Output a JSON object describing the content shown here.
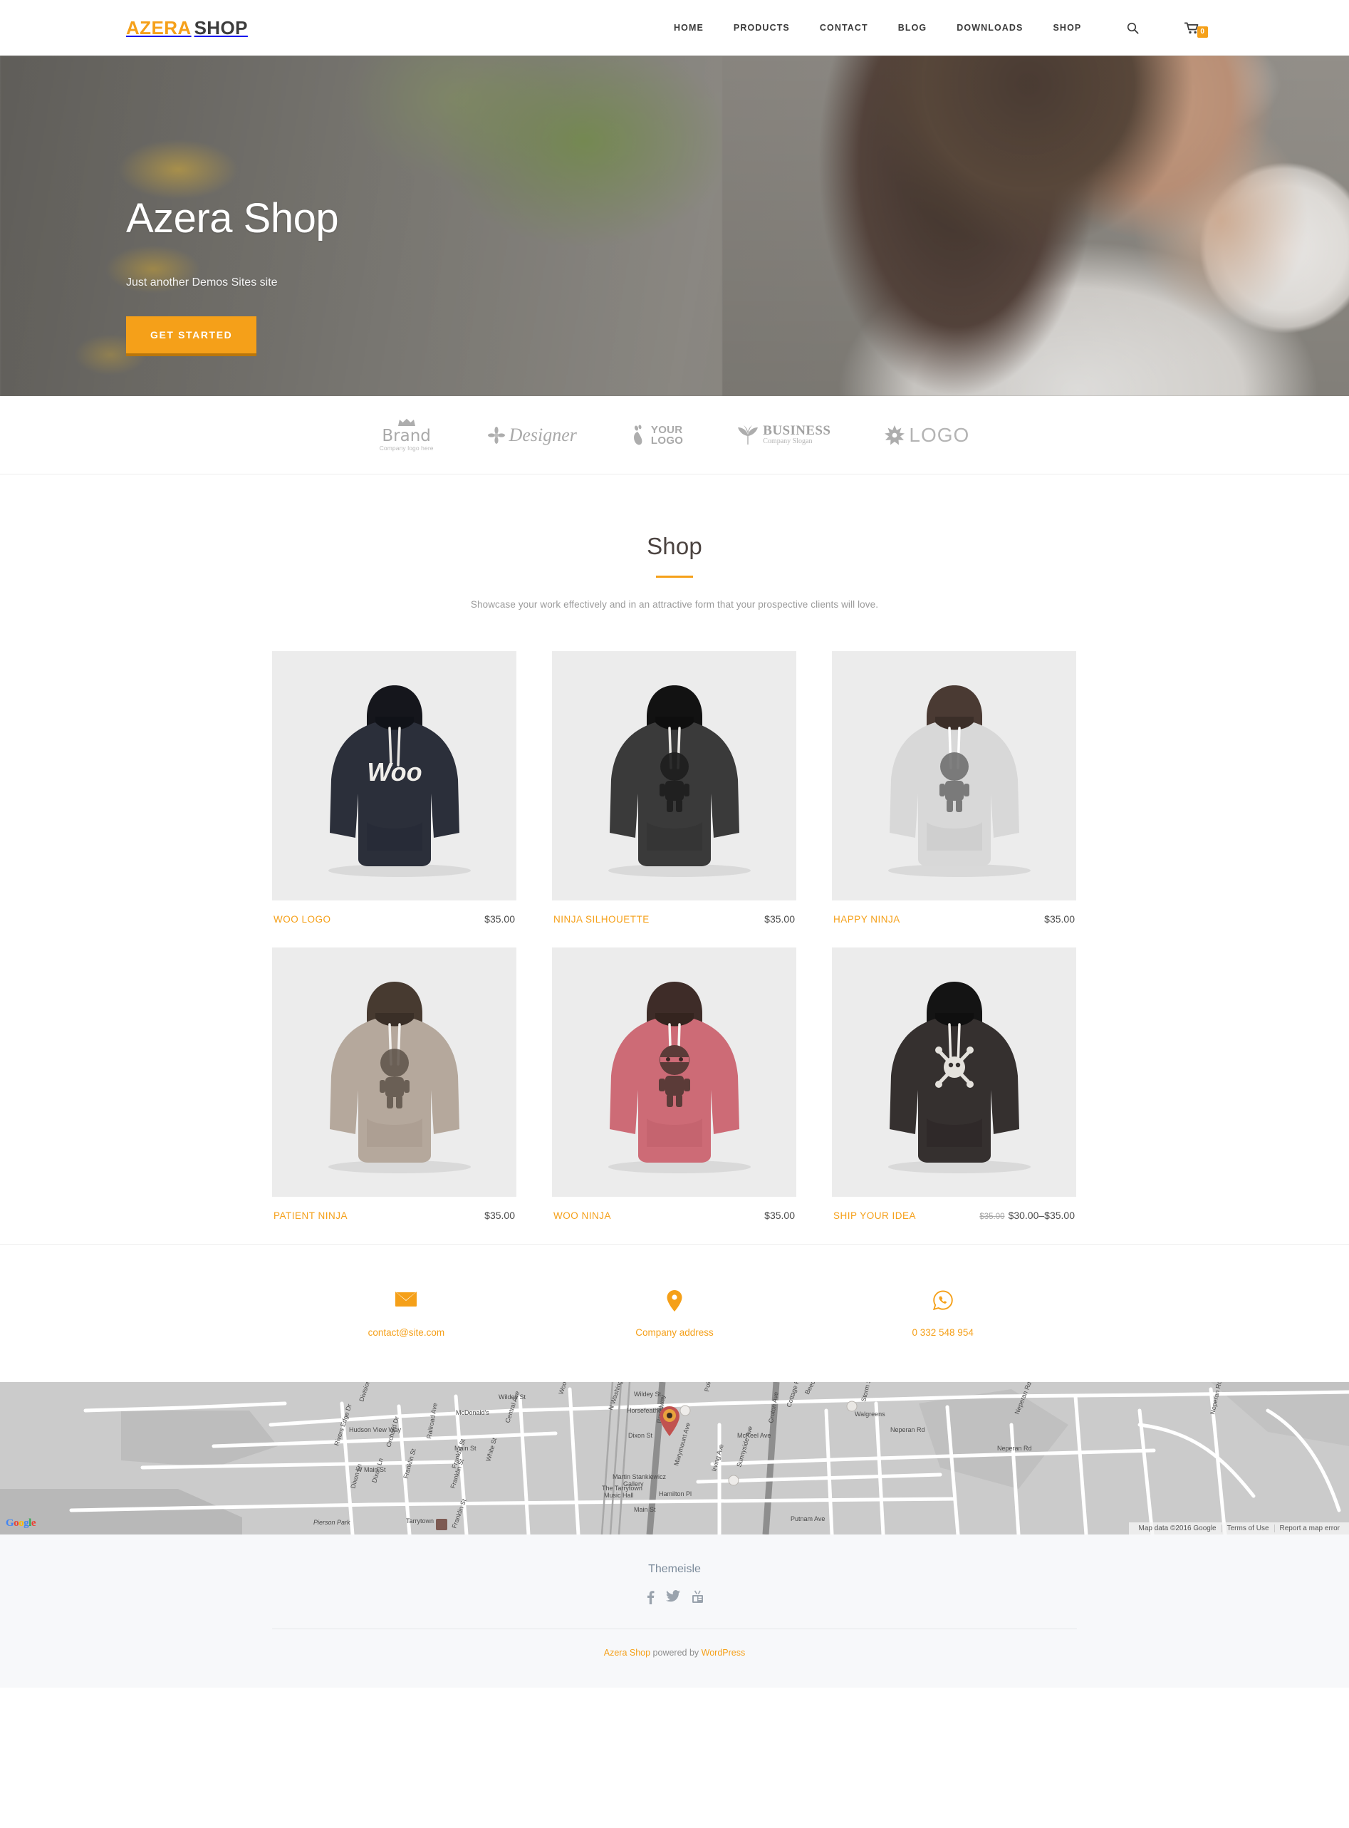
{
  "header": {
    "logo": {
      "part1": "AZERA",
      "part2": "SHOP"
    },
    "nav": [
      {
        "label": "HOME"
      },
      {
        "label": "PRODUCTS"
      },
      {
        "label": "CONTACT"
      },
      {
        "label": "BLOG"
      },
      {
        "label": "DOWNLOADS"
      },
      {
        "label": "SHOP"
      }
    ],
    "search_icon": "search-icon",
    "cart_icon": "shopping-cart-icon",
    "cart_count": "0"
  },
  "hero": {
    "title": "Azera Shop",
    "subtitle": "Just another Demos Sites site",
    "cta": "GET STARTED"
  },
  "clients": [
    {
      "name": "Brand",
      "sub": "Company logo here",
      "icon": "crown-icon"
    },
    {
      "name": "Designer",
      "sub": "",
      "icon": "flower-icon"
    },
    {
      "name": "YOUR",
      "name2": "LOGO",
      "sub": "",
      "icon": "footprint-icon"
    },
    {
      "name": "BUSINESS",
      "sub": "Company Slogan",
      "icon": "leaf-icon"
    },
    {
      "name": "LOGO",
      "sub": "",
      "icon": "starburst-icon"
    }
  ],
  "shop": {
    "title": "Shop",
    "subtitle": "Showcase your work effectively and in an attractive form that your prospective clients will love.",
    "products": [
      {
        "name": "WOO LOGO",
        "price": "$35.00",
        "old_price": "",
        "color": "#2b2f3a",
        "graphic": "woo"
      },
      {
        "name": "NINJA SILHOUETTE",
        "price": "$35.00",
        "old_price": "",
        "color": "#3a3a3a",
        "graphic": "ninja"
      },
      {
        "name": "HAPPY NINJA",
        "price": "$35.00",
        "old_price": "",
        "color": "#d8d8d8",
        "graphic": "ninja"
      },
      {
        "name": "PATIENT NINJA",
        "price": "$35.00",
        "old_price": "",
        "color": "#b5a89c",
        "graphic": "ninja"
      },
      {
        "name": "WOO NINJA",
        "price": "$35.00",
        "old_price": "",
        "color": "#cd6b76",
        "graphic": "ninja"
      },
      {
        "name": "SHIP YOUR IDEA",
        "price": "$30.00–$35.00",
        "old_price": "$35.00",
        "color": "#35302f",
        "graphic": "bones"
      }
    ]
  },
  "contact": [
    {
      "icon": "envelope-icon",
      "label": "contact@site.com"
    },
    {
      "icon": "map-pin-icon",
      "label": "Company address"
    },
    {
      "icon": "whatsapp-phone-icon",
      "label": "0 332 548 954"
    }
  ],
  "map": {
    "google_logo": {
      "g1": "G",
      "o1": "o",
      "o2": "o",
      "g2": "g",
      "l": "l",
      "e": "e"
    },
    "attribution": "Map data ©2016 Google",
    "terms": "Terms of Use",
    "report": "Report a map error",
    "streets": [
      "Division St",
      "Wildey St",
      "McDonald's",
      "Central Ave",
      "Wood Ct",
      "Pokahoe Dr",
      "Wildey St",
      "Beech Ln",
      "Horsefeathers",
      "N Washington St",
      "Dixon St",
      "Broadway",
      "McKeel Ave",
      "Croton Ave",
      "Neperan Rd",
      "Neperan Rd",
      "Neperan Rd",
      "Hudson View Way",
      "Walgreens",
      "Rivers Edge Dr",
      "Orchard Dr",
      "Railroad Ave",
      "Main St",
      "Cottage Pl",
      "Storm St",
      "W Main St",
      "Franklin St",
      "White St",
      "Martin Stankiewicz",
      "Gallery",
      "Marymount Ave",
      "Irving Ave",
      "Sunnyside Ave",
      "The Tarrytown",
      "Music Hall",
      "Hamilton Pl",
      "Main St",
      "Pierson Park",
      "Tarrytown",
      "Putnam Ave",
      "Dixon Ln"
    ]
  },
  "footer": {
    "title": "Themeisle",
    "social": [
      {
        "icon": "facebook-icon"
      },
      {
        "icon": "twitter-icon"
      },
      {
        "icon": "youtube-icon"
      }
    ],
    "copy_link1": "Azera Shop",
    "copy_middle": " powered by ",
    "copy_link2": "WordPress"
  }
}
